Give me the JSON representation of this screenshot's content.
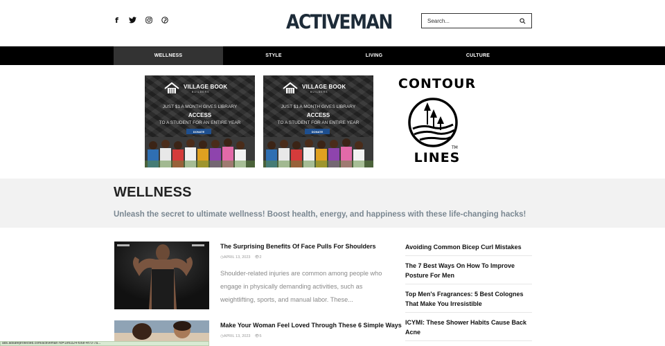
{
  "header": {
    "logo": "ACTIVEMAN",
    "social_icons": [
      "facebook-icon",
      "twitter-icon",
      "instagram-icon",
      "pinterest-icon"
    ],
    "search": {
      "placeholder": "Search..."
    }
  },
  "nav": {
    "items": [
      {
        "label": "WELLNESS",
        "active": true
      },
      {
        "label": "STYLE",
        "active": false
      },
      {
        "label": "LIVING",
        "active": false
      },
      {
        "label": "CULTURE",
        "active": false
      }
    ]
  },
  "ads": [
    {
      "brand": "VILLAGE BOOK",
      "brand_sub": "BUILDERS",
      "line1": "JUST $1 A MONTH GIVES LIBRARY",
      "line2": "ACCESS",
      "line3": "TO A STUDENT FOR AN ENTIRE YEAR",
      "button": "DONATE"
    },
    {
      "brand": "VILLAGE BOOK",
      "brand_sub": "BUILDERS",
      "line1": "JUST $1 A MONTH GIVES LIBRARY",
      "line2": "ACCESS",
      "line3": "TO A STUDENT FOR AN ENTIRE YEAR",
      "button": "DONATE"
    }
  ],
  "contour_ad": {
    "top": "CONTOUR",
    "bottom": "LINES",
    "tm": "TM"
  },
  "category": {
    "title": "WELLNESS",
    "description": "Unleash the secret to ultimate wellness! Boost health, energy, and happiness with these life-changing hacks!"
  },
  "articles": [
    {
      "title": "The Surprising Benefits Of Face Pulls For Shoulders",
      "date": "APRIL 13, 2023",
      "views": "2",
      "excerpt": "Shoulder-related injuries are common among people who engage in physically demanding activities, such as weightlifting, sports, and manual labor. These..."
    },
    {
      "title": "Make Your Woman Feel Loved Through These 6 Simple Ways",
      "date": "APRIL 13, 2023",
      "views": "5"
    }
  ],
  "sidebar": {
    "items": [
      "Avoiding Common Bicep Curl Mistakes",
      "The 7 Best Ways On How To Improve Posture For Men",
      "Top Men's Fragrances: 5 Best Colognes That Make You Irresistible",
      "ICYMI: These Shower Habits Cause Back Acne"
    ]
  },
  "status_bar": "ads.adsafeprotected.com/activeman?id=1ef0324-f06e-4f70-7a..."
}
